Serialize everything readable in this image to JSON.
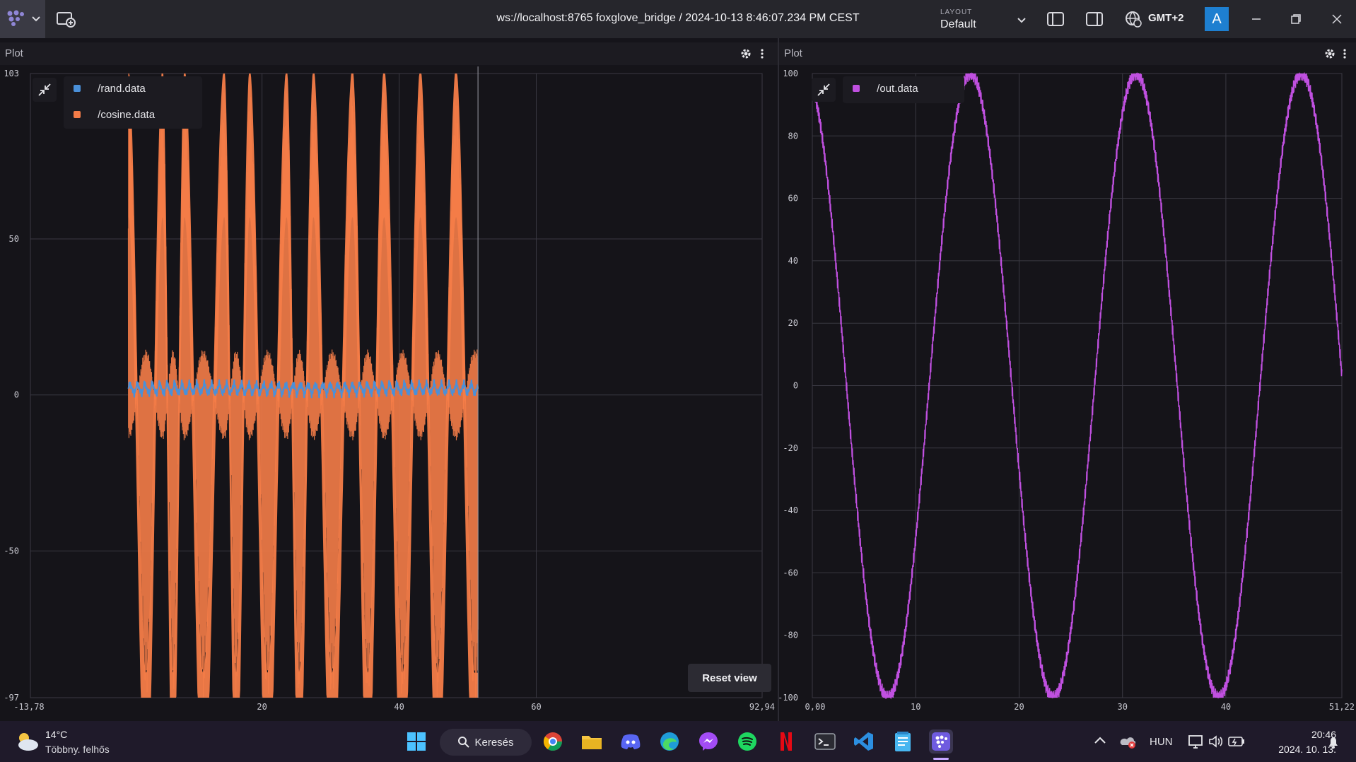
{
  "window": {
    "title": "ws://localhost:8765 foxglove_bridge / 2024-10-13 8:46:07.234 PM CEST",
    "layout_caption": "LAYOUT",
    "layout_value": "Default",
    "timezone": "GMT+2",
    "avatar_letter": "A"
  },
  "left_panel": {
    "title": "Plot",
    "legend": [
      {
        "label": "/rand.data",
        "color": "#4a90d9"
      },
      {
        "label": "/cosine.data",
        "color": "#f47c48"
      }
    ],
    "y_ticks": [
      "103",
      "50",
      "0",
      "-50",
      "-97"
    ],
    "x_ticks": [
      "-13,78",
      "20",
      "40",
      "60",
      "92,94"
    ],
    "reset_label": "Reset view"
  },
  "right_panel": {
    "title": "Plot",
    "legend": [
      {
        "label": "/out.data",
        "color": "#c050e0"
      }
    ],
    "y_ticks": [
      "100",
      "80",
      "60",
      "40",
      "20",
      "0",
      "-20",
      "-40",
      "-60",
      "-80",
      "-100"
    ],
    "x_ticks": [
      "0,00",
      "10",
      "20",
      "30",
      "40",
      "51,22"
    ]
  },
  "chart_data": [
    {
      "type": "line",
      "xlim": [
        -13.78,
        92.94
      ],
      "ylim": [
        -97,
        103
      ],
      "grid": true,
      "legend_position": "top-left",
      "series": [
        {
          "name": "/rand.data",
          "color": "#4a90d9",
          "x_range": [
            0.5,
            51.5
          ],
          "y_center": 2,
          "y_noise": 3
        },
        {
          "name": "/cosine.data",
          "color": "#f47c48",
          "x_range": [
            0.5,
            51.5
          ],
          "amplitude": 97,
          "crest_x": [
            0.5,
            5.5,
            8.7,
            14.5,
            18.2,
            23.6,
            27.5,
            33.2,
            37.8,
            43.1,
            48.3
          ],
          "trough_x": [
            3.1,
            7.0,
            11.4,
            16.2,
            20.8,
            25.4,
            30.2,
            35.4,
            40.5,
            45.6,
            51.0
          ]
        }
      ]
    },
    {
      "type": "line",
      "xlim": [
        0,
        51.22
      ],
      "ylim": [
        -100,
        100
      ],
      "grid": true,
      "legend_position": "top-left",
      "series": [
        {
          "name": "/out.data",
          "color": "#c050e0",
          "amplitude": 100,
          "period": 16,
          "phase_peak_x": 15.3
        }
      ]
    }
  ],
  "taskbar": {
    "weather_temp": "14°C",
    "weather_desc": "Többny. felhős",
    "search_label": "Keresés",
    "lang": "HUN",
    "time": "20:46",
    "date": "2024. 10. 13."
  }
}
